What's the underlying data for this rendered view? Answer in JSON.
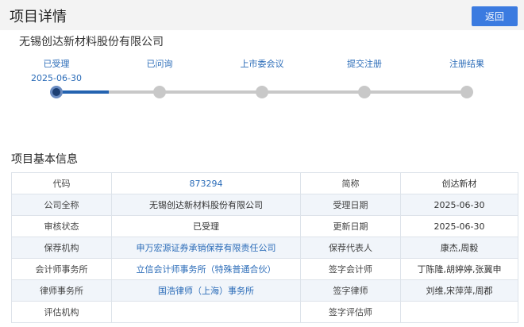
{
  "header": {
    "title": "项目详情",
    "back_label": "返回"
  },
  "company": {
    "name": "无锡创达新材料股份有限公司"
  },
  "progress": {
    "steps": [
      {
        "label": "已受理",
        "date": "2025-06-30"
      },
      {
        "label": "已问询",
        "date": ""
      },
      {
        "label": "上市委会议",
        "date": ""
      },
      {
        "label": "提交注册",
        "date": ""
      },
      {
        "label": "注册结果",
        "date": ""
      }
    ],
    "current_step": 1,
    "colors": {
      "active": "#2463b0",
      "inactive": "#c8c8c8"
    }
  },
  "basic_info": {
    "title": "项目基本信息",
    "rows": [
      {
        "label1": "代码",
        "value1": "873294",
        "label2": "简称",
        "value2": "创达新材"
      },
      {
        "label1": "公司全称",
        "value1": "无锡创达新材料股份有限公司",
        "label2": "受理日期",
        "value2": "2025-06-30"
      },
      {
        "label1": "审核状态",
        "value1": "已受理",
        "label2": "更新日期",
        "value2": "2025-06-30"
      },
      {
        "label1": "保荐机构",
        "value1": "申万宏源证券承销保荐有限责任公司",
        "label2": "保荐代表人",
        "value2": "康杰,周毅"
      },
      {
        "label1": "会计师事务所",
        "value1": "立信会计师事务所（特殊普通合伙）",
        "label2": "签字会计师",
        "value2": "丁陈隆,胡婷婷,张冀申"
      },
      {
        "label1": "律师事务所",
        "value1": "国浩律师（上海）事务所",
        "label2": "签字律师",
        "value2": "刘维,宋萍萍,周郡"
      },
      {
        "label1": "评估机构",
        "value1": "",
        "label2": "签字评估师",
        "value2": ""
      }
    ]
  }
}
